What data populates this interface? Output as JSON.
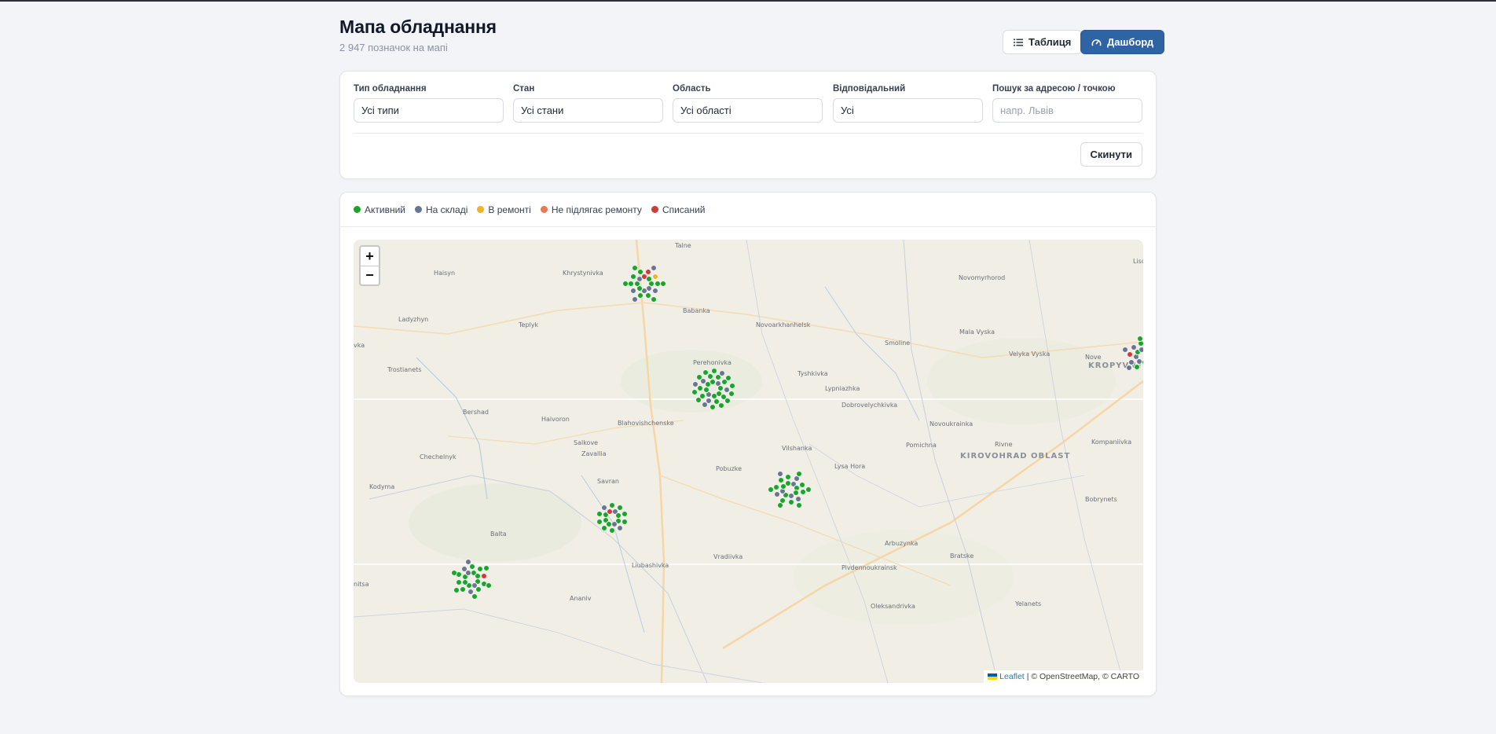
{
  "header": {
    "title": "Мапа обладнання",
    "subtitle": "2 947 позначок на мапі",
    "table_button": "Таблиця",
    "dashboard_button": "Дашборд"
  },
  "filters": {
    "type": {
      "label": "Тип обладнання",
      "value": "Усі типи"
    },
    "status": {
      "label": "Стан",
      "value": "Усі стани"
    },
    "region": {
      "label": "Область",
      "value": "Усі області"
    },
    "responsible": {
      "label": "Відповідальний",
      "value": "Усі"
    },
    "search": {
      "label": "Пошук за адресою / точкою",
      "placeholder": "напр. Львів"
    },
    "reset_button": "Скинути"
  },
  "legend": [
    {
      "label": "Активний",
      "color": "#1aa52a"
    },
    {
      "label": "На складі",
      "color": "#6b7590"
    },
    {
      "label": "В ремонті",
      "color": "#f0b323"
    },
    {
      "label": "Не підлягає ремонту",
      "color": "#e17c55"
    },
    {
      "label": "Списаний",
      "color": "#cf3b3b"
    }
  ],
  "map": {
    "zoom_in": "+",
    "zoom_out": "−",
    "attribution_link": "Leaflet",
    "attribution_text": "| © OpenStreetMap, © CARTO",
    "places": {
      "talne": "Talne",
      "haisyn": "Haisyn",
      "khrystynivka": "Khrystynivka",
      "lisova": "Liso",
      "novomyrhorod": "Novomyrhorod",
      "ladyzhyn": "Ladyzhyn",
      "teplyk": "Teplyk",
      "babanka": "Babanka",
      "novoarkhanhelsk": "Novoarkhanhelsk",
      "mala_vyska": "Mala Vyska",
      "smoline": "Smoline",
      "vka": "vka",
      "perehonivka": "Perehonivka",
      "velyka_vyska": "Velyka Vyska",
      "trostianets": "Trostianets",
      "tyshkivka": "Tyshkivka",
      "kropyvnytskyi": "KROPYVNYTS",
      "nove": "Nove",
      "lypniazhka": "Lypniazhka",
      "dobrovelychkivka": "Dobrovelychkivka",
      "bershad": "Bershad",
      "haivoron": "Haivoron",
      "blahovishchenske": "Blahovishchenske",
      "novoukrainka": "Novoukrainka",
      "salkove": "Salkove",
      "vilshanka": "Vilshanka",
      "pomichna": "Pomichna",
      "rivne": "Rivne",
      "kompaniivka": "Kompaniivka",
      "chechelnyk": "Chechelnyk",
      "zavallia": "Zavallia",
      "kirovohrad_oblast": "KIROVOHRAD OBLAST",
      "pobuzke": "Pobuzke",
      "lysa_hora": "Lysa Hora",
      "kodyma": "Kodyma",
      "savran": "Savran",
      "bobrynets": "Bobrynets",
      "balta": "Balta",
      "arbuzynka": "Arbuzynka",
      "bratske": "Bratske",
      "vradiivka": "Vradiivka",
      "liubashivka": "Liubashivka",
      "pivdennoukrainsk": "Pivdennoukrainsk",
      "nitsa": "nitsa",
      "ananiv": "Ananiv",
      "yelanets": "Yelanets",
      "oleksandrivka": "Oleksandrivka"
    },
    "clusters": [
      {
        "status": [
          0,
          1,
          1,
          0,
          0,
          1,
          4,
          0,
          0,
          1,
          0,
          0,
          1,
          0,
          0,
          0,
          4,
          2,
          0,
          0,
          1,
          0,
          0,
          1
        ]
      },
      {
        "status": [
          0,
          0,
          1,
          0,
          0,
          0,
          1,
          0,
          0,
          0,
          1,
          0,
          0,
          1,
          0,
          0,
          0,
          1,
          0,
          0,
          0,
          1,
          0,
          0,
          1,
          0,
          0,
          0,
          1,
          0,
          0,
          0
        ]
      },
      {
        "status": [
          0,
          1,
          1,
          0,
          1,
          0,
          1,
          1,
          0,
          0,
          1,
          4,
          1,
          0,
          1,
          0,
          0,
          1,
          0,
          1,
          1,
          0,
          0,
          0
        ]
      },
      {
        "status": [
          0,
          1,
          0,
          0,
          1,
          0,
          0,
          1,
          0,
          1,
          0,
          0,
          0,
          1,
          0,
          0,
          1,
          0,
          0,
          0,
          1,
          0,
          0,
          0
        ]
      },
      {
        "status": [
          0,
          0,
          4,
          1,
          0,
          0,
          1,
          0,
          0,
          0,
          1,
          0,
          0,
          0,
          0,
          1,
          0,
          0
        ]
      },
      {
        "status": [
          0,
          1,
          0,
          0,
          0,
          1,
          0,
          0,
          0,
          1,
          0,
          0,
          4,
          0,
          0,
          1,
          0,
          0,
          0,
          1,
          0,
          0,
          0,
          0
        ]
      }
    ]
  }
}
